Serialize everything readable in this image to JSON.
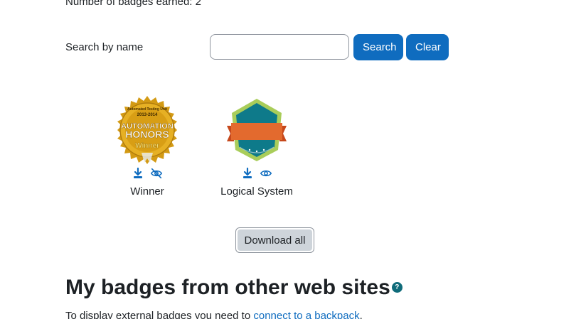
{
  "summary": {
    "badge_count_text": "Number of badges earned: 2"
  },
  "search": {
    "label": "Search by name",
    "value": "",
    "placeholder": "",
    "search_label": "Search",
    "clear_label": "Clear"
  },
  "badges": [
    {
      "name": "Winner",
      "image_text_top": "2013-2014",
      "image_text_ring": "Automated Testing Unit",
      "image_text_line1": "AUTOMATION",
      "image_text_line2": "HONORS",
      "image_text_line3": "Winner",
      "actions": [
        "download-icon",
        "eye-slash-icon"
      ]
    },
    {
      "name": "Logical System",
      "actions": [
        "download-icon",
        "eye-icon"
      ]
    }
  ],
  "download_all_label": "Download all",
  "external": {
    "heading": "My badges from other web sites",
    "help_icon": "?",
    "text_prefix": "To display external badges you need to ",
    "link_text": "connect to a backpack",
    "text_suffix": "."
  },
  "colors": {
    "primary": "#0f6cbf",
    "help": "#0f6b7a",
    "badge_gold": "#d9a21b",
    "badge_teal": "#0e7a8a",
    "badge_ribbon": "#e36a2e"
  }
}
